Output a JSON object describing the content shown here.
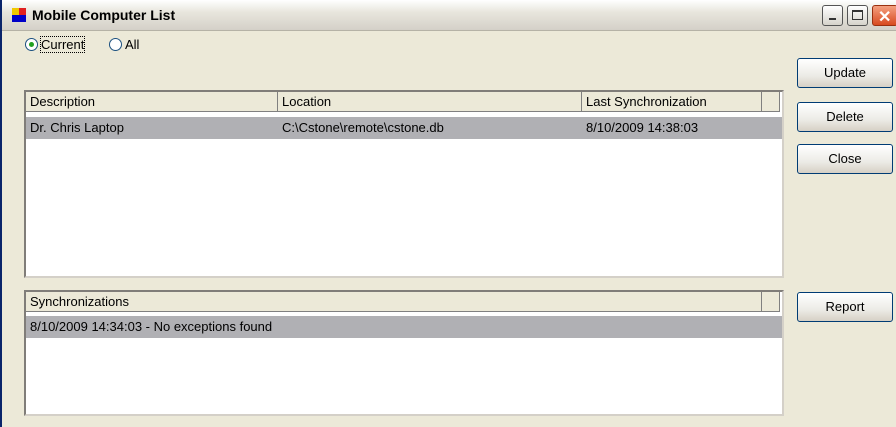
{
  "window": {
    "title": "Mobile Computer List"
  },
  "filter": {
    "options": [
      {
        "label": "Current",
        "selected": true
      },
      {
        "label": "All",
        "selected": false
      }
    ]
  },
  "computers": {
    "columns": [
      "Description",
      "Location",
      "Last Synchronization"
    ],
    "rows": [
      {
        "description": "Dr. Chris Laptop",
        "location": "C:\\Cstone\\remote\\cstone.db",
        "last_sync": "8/10/2009 14:38:03",
        "selected": true
      }
    ]
  },
  "synchronizations": {
    "columns": [
      "Synchronizations"
    ],
    "rows": [
      {
        "text": "8/10/2009 14:34:03 - No exceptions found",
        "selected": true
      }
    ]
  },
  "buttons": {
    "update": "Update",
    "delete": "Delete",
    "close": "Close",
    "report": "Report"
  },
  "colors": {
    "selection": "#b0b0b4",
    "face": "#ece9d8"
  }
}
